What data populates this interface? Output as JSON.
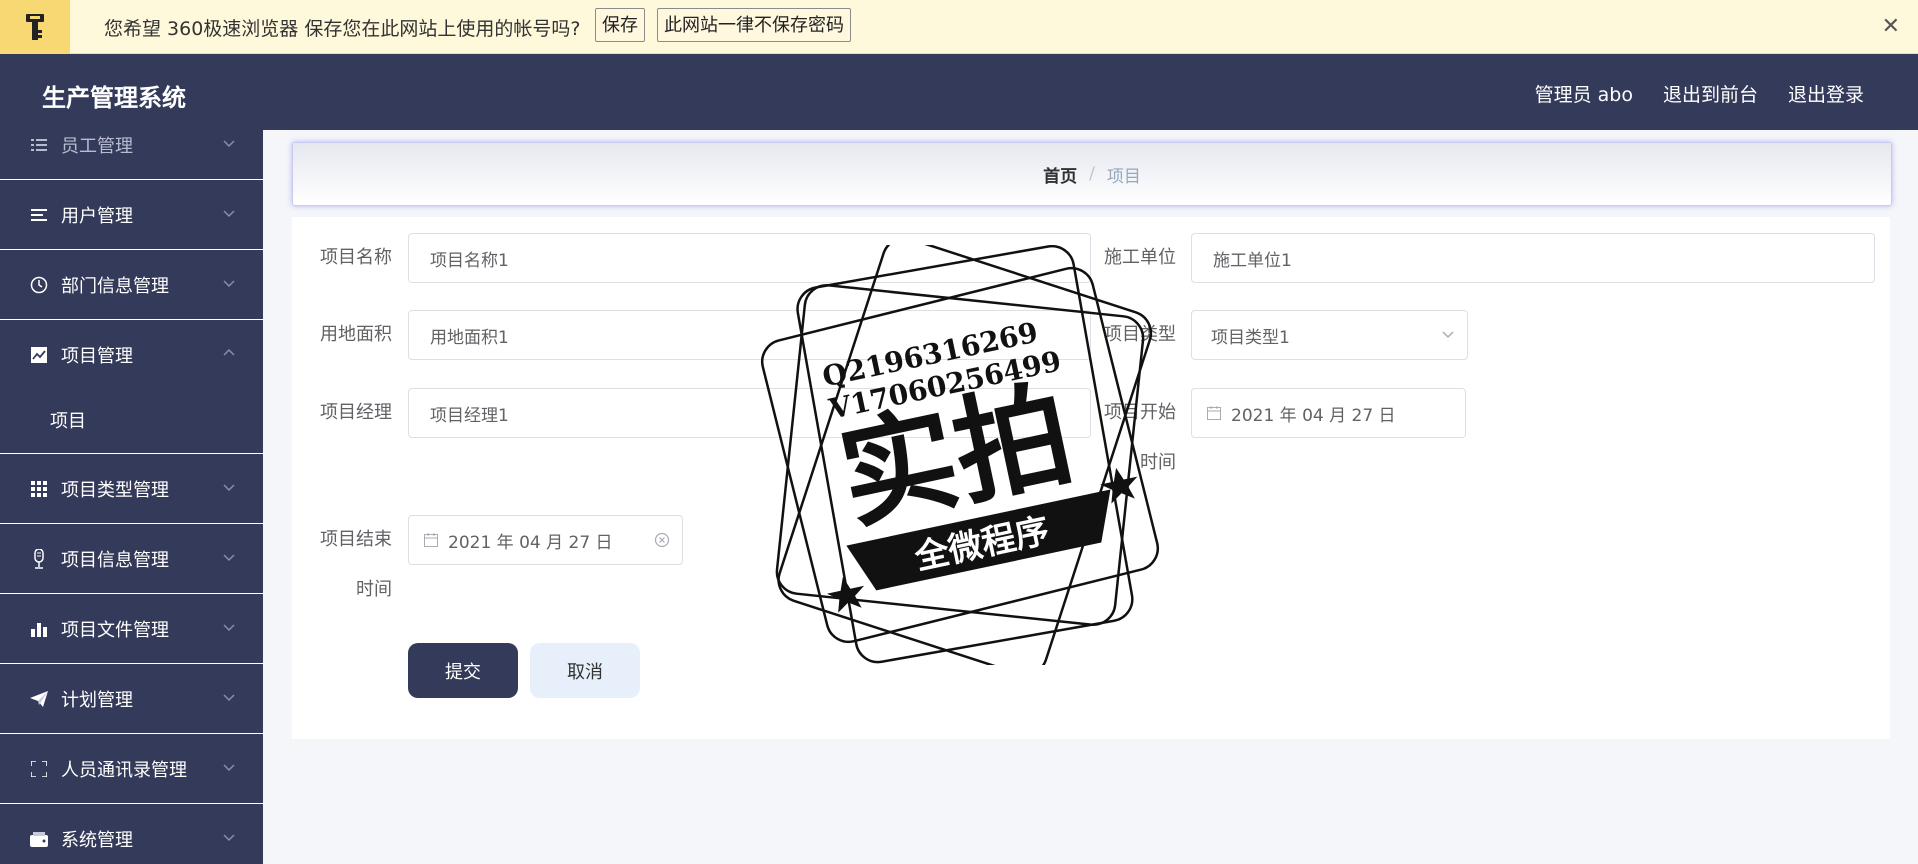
{
  "password_bar": {
    "message": "您希望 360极速浏览器 保存您在此网站上使用的帐号吗?",
    "save_label": "保存",
    "never_label": "此网站一律不保存密码",
    "close_glyph": "✕"
  },
  "header": {
    "brand": "生产管理系统",
    "admin": "管理员 abo",
    "front": "退出到前台",
    "logout": "退出登录"
  },
  "sidebar": {
    "items": [
      {
        "label": "员工管理",
        "icon": "list-icon"
      },
      {
        "label": "用户管理",
        "icon": "lines-icon"
      },
      {
        "label": "部门信息管理",
        "icon": "clock-icon"
      },
      {
        "label": "项目管理",
        "icon": "chart-icon",
        "expanded": true
      },
      {
        "label": "项目类型管理",
        "icon": "grid-icon"
      },
      {
        "label": "项目信息管理",
        "icon": "mic-icon"
      },
      {
        "label": "项目文件管理",
        "icon": "bar-chart-icon"
      },
      {
        "label": "计划管理",
        "icon": "paper-plane-icon"
      },
      {
        "label": "人员通讯录管理",
        "icon": "frame-icon"
      },
      {
        "label": "系统管理",
        "icon": "wallet-icon"
      }
    ],
    "sub_item": "项目"
  },
  "breadcrumb": {
    "home": "首页",
    "sep": "/",
    "current": "项目"
  },
  "form": {
    "name_label": "项目名称",
    "name_value": "项目名称1",
    "unit_label": "施工单位",
    "unit_value": "施工单位1",
    "area_label": "用地面积",
    "area_value": "用地面积1",
    "type_label": "项目类型",
    "type_value": "项目类型1",
    "manager_label": "项目经理",
    "manager_value": "项目经理1",
    "start_label_1": "项目开始",
    "start_label_2": "时间",
    "start_value": "2021 年 04 月 27 日",
    "end_label_1": "项目结束",
    "end_label_2": "时间",
    "end_value": "2021 年 04 月 27 日",
    "submit": "提交",
    "cancel": "取消"
  },
  "watermark": {
    "line1": "Q2196316269",
    "line2": "V17060256499",
    "big": "实拍",
    "ribbon": "全微程序"
  },
  "colors": {
    "sidebar": "#343a5a",
    "password_bar": "#fff9dc",
    "accent_key": "#f8d873"
  }
}
